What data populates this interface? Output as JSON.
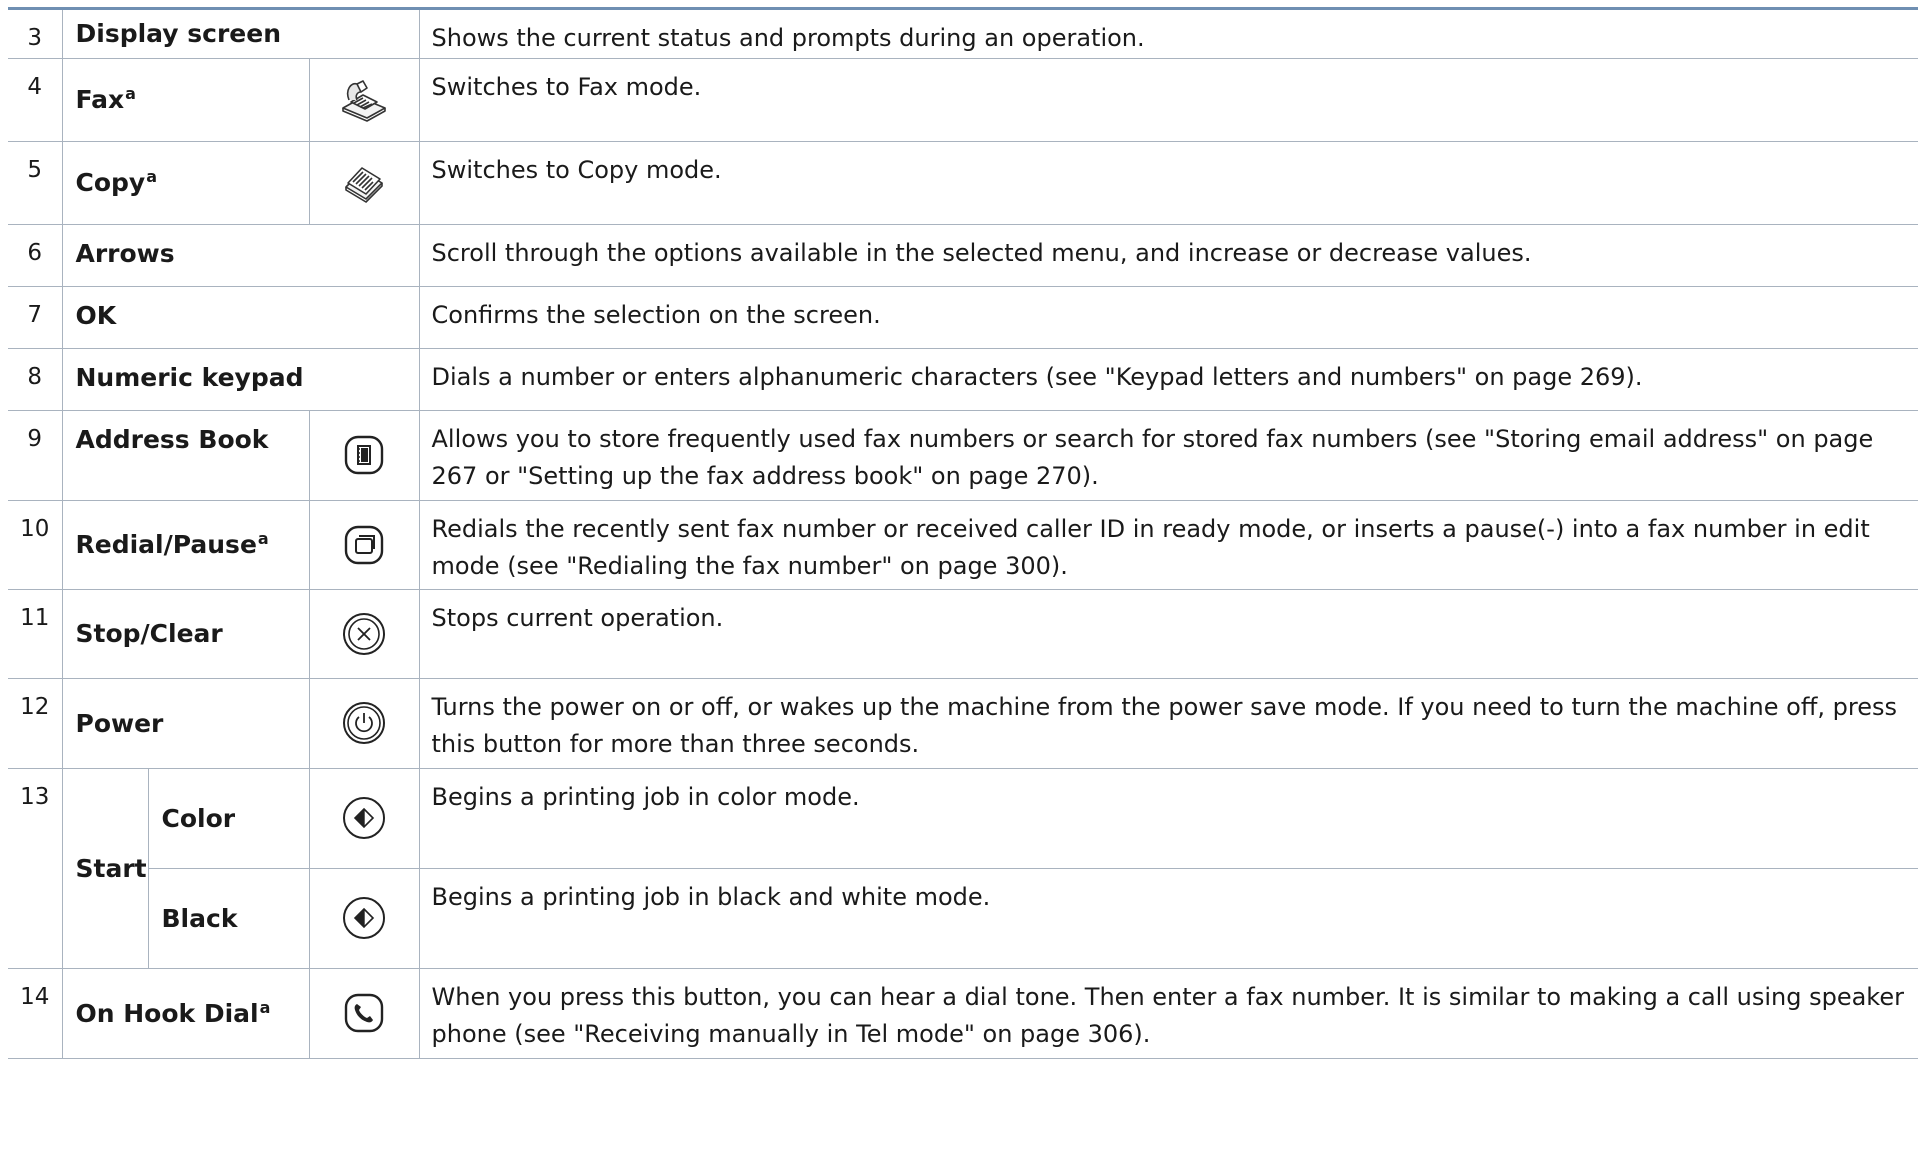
{
  "rows": [
    {
      "num": "3",
      "name": "Display screen",
      "desc": "Shows the current status and prompts during an operation."
    },
    {
      "num": "4",
      "name": "Fax",
      "sup": "a",
      "icon": "fax-icon",
      "desc": "Switches to Fax mode."
    },
    {
      "num": "5",
      "name": "Copy",
      "sup": "a",
      "icon": "copy-icon",
      "desc": "Switches to Copy mode."
    },
    {
      "num": "6",
      "name": "Arrows",
      "desc": "Scroll through the options available in the selected menu, and increase or decrease values."
    },
    {
      "num": "7",
      "name": "OK",
      "desc": "Confirms the selection on the screen."
    },
    {
      "num": "8",
      "name": "Numeric keypad",
      "desc": "Dials a number or enters alphanumeric characters (see \"Keypad letters and numbers\" on page 269)."
    },
    {
      "num": "9",
      "name": "Address Book",
      "icon": "address-book-icon",
      "desc": "Allows you to store frequently used fax numbers or search for stored fax numbers (see \"Storing email address\" on page 267 or \"Setting up the fax address book\" on page 270)."
    },
    {
      "num": "10",
      "name": "Redial/Pause",
      "sup": "a",
      "icon": "redial-pause-icon",
      "desc": "Redials the recently sent fax number or received caller ID in ready mode, or inserts a pause(-) into a fax number in edit mode (see \"Redialing the fax number\" on page 300)."
    },
    {
      "num": "11",
      "name": "Stop/Clear",
      "icon": "stop-clear-icon",
      "desc": "Stops current operation."
    },
    {
      "num": "12",
      "name": "Power",
      "icon": "power-icon",
      "desc": "Turns the power on or off, or wakes up the machine from the power save mode. If you need to turn the machine off, press this button for more than three seconds."
    },
    {
      "num": "13",
      "name": "Start",
      "subs": [
        {
          "name": "Color",
          "icon": "start-icon",
          "desc": "Begins a printing job in color mode."
        },
        {
          "name": "Black",
          "icon": "start-icon",
          "desc": "Begins a printing job in black and white mode."
        }
      ]
    },
    {
      "num": "14",
      "name": "On Hook Dial",
      "sup": "a",
      "icon": "on-hook-dial-icon",
      "desc": "When you press this button, you can hear a dial tone. Then enter a fax number. It is similar to making a call using speaker phone (see \"Receiving manually in Tel mode\" on page 306)."
    }
  ]
}
